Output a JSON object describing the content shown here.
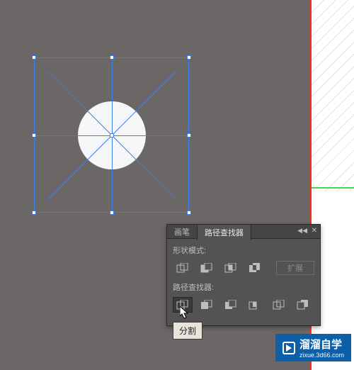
{
  "canvas": {
    "shape": "circle-with-radial-lines",
    "selection_handles": 9
  },
  "panel": {
    "tabs": [
      {
        "label": "画笔",
        "active": false
      },
      {
        "label": "路径查找器",
        "active": true
      }
    ],
    "sections": {
      "shape_modes": {
        "label": "形状模式:",
        "expand_label": "扩展"
      },
      "pathfinders": {
        "label": "路径查找器:"
      }
    }
  },
  "tooltip": {
    "text": "分割"
  },
  "icons": {
    "unite": "unite-icon",
    "minus_front": "minus-front-icon",
    "intersect": "intersect-icon",
    "exclude": "exclude-icon",
    "divide": "divide-icon",
    "trim": "trim-icon",
    "merge": "merge-icon",
    "crop": "crop-icon",
    "outline": "outline-icon",
    "minus_back": "minus-back-icon"
  },
  "watermark": {
    "brand": "溜溜自学",
    "site": "zixue.3d66.com"
  }
}
